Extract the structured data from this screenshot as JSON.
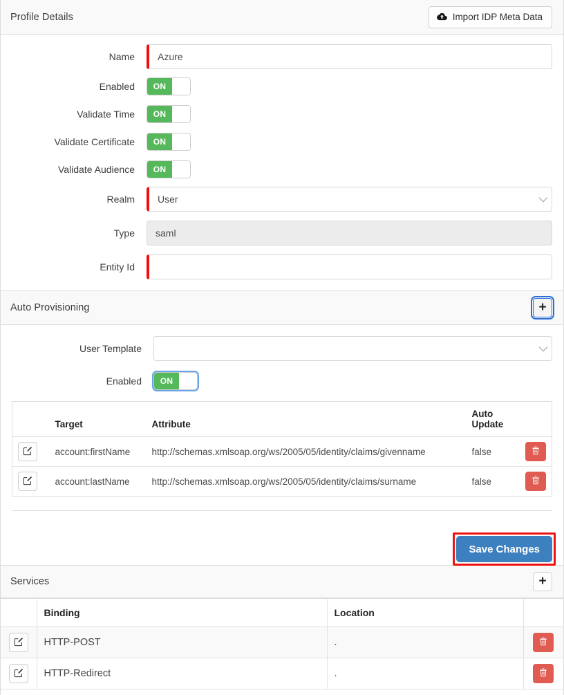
{
  "profile_details": {
    "title": "Profile Details",
    "import_button": {
      "label": "Import IDP Meta Data",
      "icon": "cloud-upload-icon"
    },
    "fields": {
      "name": {
        "label": "Name",
        "value": "Azure",
        "required": true
      },
      "enabled": {
        "label": "Enabled",
        "toggle_label": "ON",
        "state": "on"
      },
      "validate_time": {
        "label": "Validate Time",
        "toggle_label": "ON",
        "state": "on"
      },
      "validate_certificate": {
        "label": "Validate Certificate",
        "toggle_label": "ON",
        "state": "on"
      },
      "validate_audience": {
        "label": "Validate Audience",
        "toggle_label": "ON",
        "state": "on"
      },
      "realm": {
        "label": "Realm",
        "value": "User",
        "required": true,
        "options": [
          "User"
        ]
      },
      "type": {
        "label": "Type",
        "value": "saml",
        "readonly": true
      },
      "entity_id": {
        "label": "Entity Id",
        "value": "",
        "required": true
      }
    }
  },
  "auto_provisioning": {
    "title": "Auto Provisioning",
    "add_button_label": "+",
    "fields": {
      "user_template": {
        "label": "User Template",
        "value": "",
        "options": []
      },
      "enabled": {
        "label": "Enabled",
        "toggle_label": "ON",
        "state": "on"
      }
    },
    "table": {
      "headers": [
        "",
        "Target",
        "Attribute",
        "Auto Update",
        ""
      ],
      "rows": [
        {
          "target": "account:firstName",
          "attribute": "http://schemas.xmlsoap.org/ws/2005/05/identity/claims/givenname",
          "auto_update": "false"
        },
        {
          "target": "account:lastName",
          "attribute": "http://schemas.xmlsoap.org/ws/2005/05/identity/claims/surname",
          "auto_update": "false"
        }
      ]
    },
    "save_button_label": "Save Changes"
  },
  "services": {
    "title": "Services",
    "add_button_label": "+",
    "table": {
      "headers": [
        "",
        "Binding",
        "Location",
        ""
      ],
      "rows": [
        {
          "binding": "HTTP-POST",
          "location": "."
        },
        {
          "binding": "HTTP-Redirect",
          "location": "."
        }
      ]
    }
  },
  "colors": {
    "accent_blue": "#3d80bf",
    "toggle_green": "#55b95b",
    "required_red": "#f30d0d",
    "delete_red": "#e05b52",
    "annotation_red": "#ee1111",
    "focus_blue": "#2a6fd6"
  }
}
